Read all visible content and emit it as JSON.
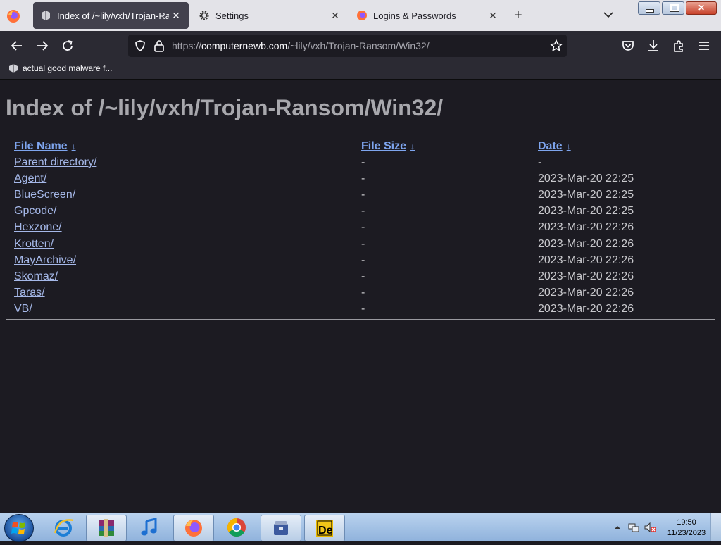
{
  "browser": {
    "tabs": [
      {
        "title": "Index of /~lily/vxh/Trojan-Rans",
        "active": true
      },
      {
        "title": "Settings",
        "active": false
      },
      {
        "title": "Logins & Passwords",
        "active": false
      }
    ],
    "url_prefix": "https://",
    "url_domain": "computernewb.com",
    "url_path": "/~lily/vxh/Trojan-Ransom/Win32/",
    "bookmark": "actual good malware f..."
  },
  "page": {
    "heading": "Index of /~lily/vxh/Trojan-Ransom/Win32/",
    "columns": {
      "name": "File Name",
      "size": "File Size",
      "date": "Date",
      "sort_glyph": "↓"
    },
    "rows": [
      {
        "name": "Parent directory/",
        "size": "-",
        "date": "-"
      },
      {
        "name": "Agent/",
        "size": "-",
        "date": "2023-Mar-20 22:25"
      },
      {
        "name": "BlueScreen/",
        "size": "-",
        "date": "2023-Mar-20 22:25"
      },
      {
        "name": "Gpcode/",
        "size": "-",
        "date": "2023-Mar-20 22:25"
      },
      {
        "name": "Hexzone/",
        "size": "-",
        "date": "2023-Mar-20 22:26"
      },
      {
        "name": "Krotten/",
        "size": "-",
        "date": "2023-Mar-20 22:26"
      },
      {
        "name": "MayArchive/",
        "size": "-",
        "date": "2023-Mar-20 22:26"
      },
      {
        "name": "Skomaz/",
        "size": "-",
        "date": "2023-Mar-20 22:26"
      },
      {
        "name": "Taras/",
        "size": "-",
        "date": "2023-Mar-20 22:26"
      },
      {
        "name": "VB/",
        "size": "-",
        "date": "2023-Mar-20 22:26"
      }
    ]
  },
  "taskbar": {
    "items": [
      "internet-explorer-icon",
      "winrar-icon",
      "itunes-icon",
      "firefox-icon",
      "chrome-icon",
      "archive-icon",
      "de-app-icon"
    ],
    "time": "19:50",
    "date": "11/23/2023"
  },
  "colors": {
    "page_bg": "#1c1b22",
    "link": "#7ea5ee",
    "heading": "#a8a8ad"
  }
}
